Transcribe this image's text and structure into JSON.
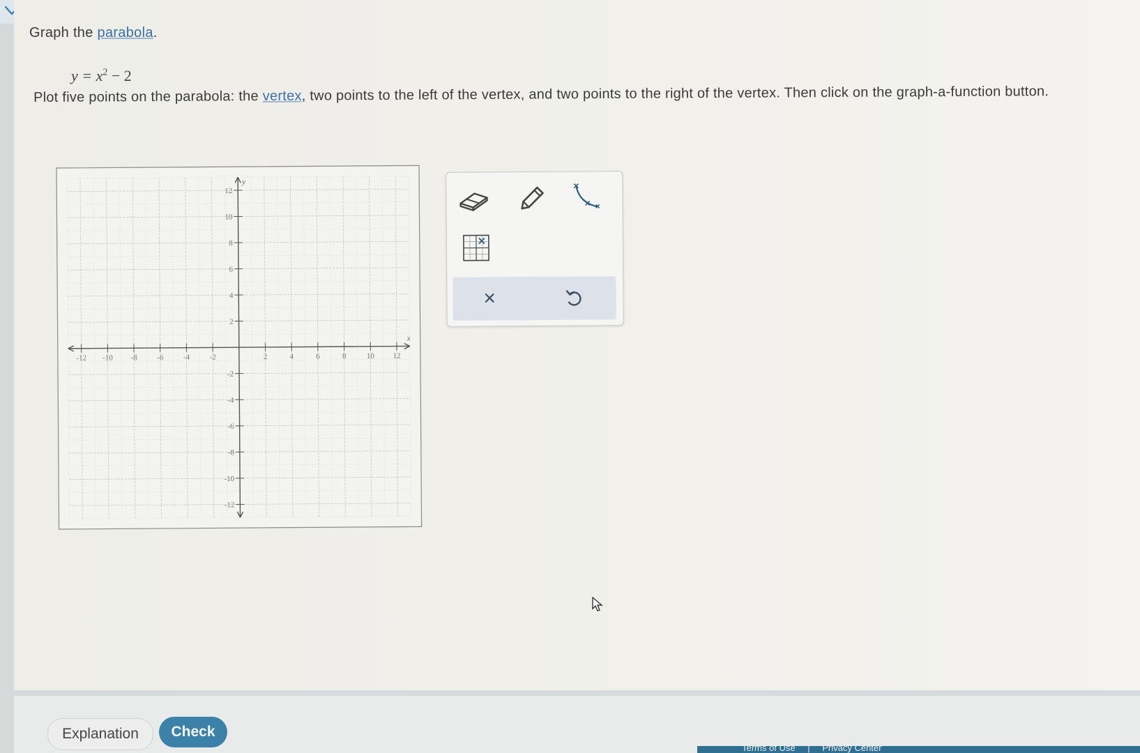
{
  "question": {
    "prompt_prefix": "Graph the",
    "prompt_link": "parabola",
    "prompt_suffix": ".",
    "equation": {
      "lhs": "y =",
      "var": "x",
      "exponent": "2",
      "tail": "− 2"
    },
    "instructions": {
      "part1": "Plot five points on the parabola: the",
      "link": "vertex",
      "part2": ", two points to the left of the vertex, and two points to the right of the vertex. Then click on the graph-a-function button."
    }
  },
  "graph": {
    "x_axis_label": "x",
    "y_axis_label": "y",
    "x_ticks": [
      "-12",
      "-10",
      "-8",
      "-6",
      "-4",
      "-2",
      "2",
      "4",
      "6",
      "8",
      "10",
      "12"
    ],
    "y_ticks": [
      "12",
      "10",
      "8",
      "6",
      "4",
      "2",
      "-2",
      "-4",
      "-6",
      "-8",
      "-10",
      "-12"
    ],
    "x_range": [
      -13,
      13
    ],
    "y_range": [
      -13,
      13
    ],
    "grid": true
  },
  "tools": {
    "eraser": "eraser-icon",
    "pencil": "pencil-icon",
    "graph_function": "graph-function-icon",
    "point_grid": "point-grid-icon",
    "clear": "×",
    "undo": "undo-icon"
  },
  "footer": {
    "explanation_label": "Explanation",
    "check_label": "Check",
    "links": [
      "Terms of Use",
      "|",
      "Privacy Center"
    ]
  },
  "colors": {
    "accent": "#3c82a8",
    "link": "#3a6fa8",
    "grid_major": "#c7c7c4",
    "grid_minor": "#dededa"
  }
}
